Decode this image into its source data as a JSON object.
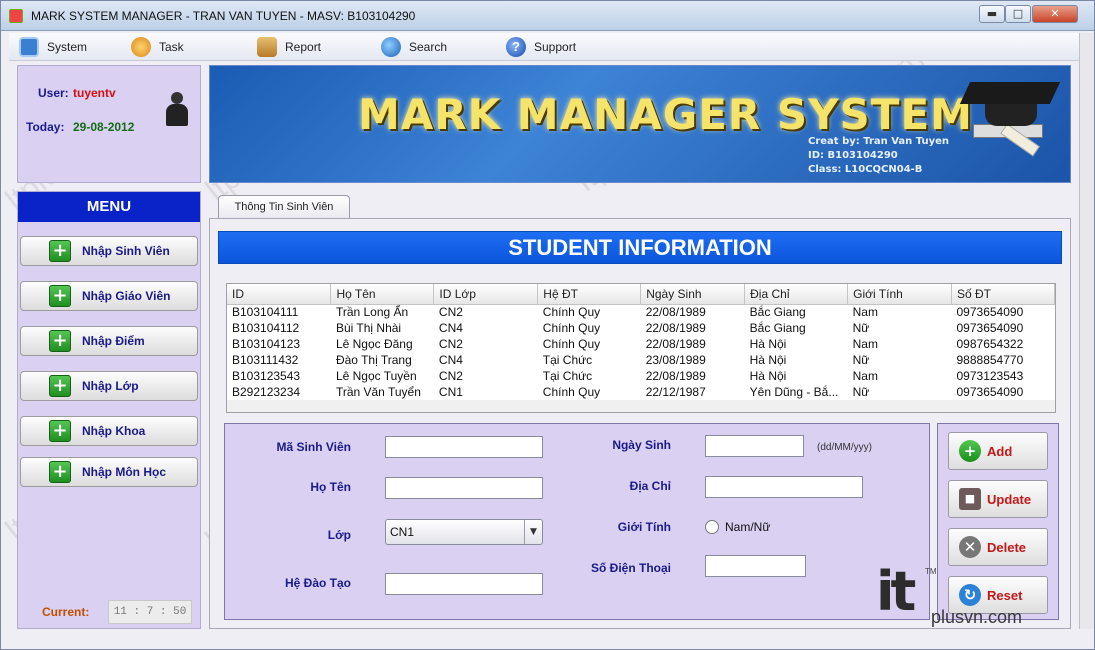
{
  "window": {
    "title": "MARK SYSTEM MANAGER -  TRAN VAN TUYEN - MASV: B103104290",
    "min_label": "▬",
    "max_label": "□",
    "close_label": "✕"
  },
  "menubar": {
    "items": [
      {
        "label": "System",
        "icon": "system-icon"
      },
      {
        "label": "Task",
        "icon": "clock-icon"
      },
      {
        "label": "Report",
        "icon": "report-icon"
      },
      {
        "label": "Search",
        "icon": "search-icon"
      },
      {
        "label": "Support",
        "icon": "help-icon"
      }
    ],
    "support_glyph": "?"
  },
  "user_panel": {
    "user_label": "User:",
    "user_value": "tuyentv",
    "today_label": "Today:",
    "today_value": "29-08-2012"
  },
  "banner": {
    "title": "MARK MANAGER SYSTEM",
    "created_by": "Creat by: Tran Van Tuyen",
    "id": "ID: B103104290",
    "class": "Class: L10CQCN04-B"
  },
  "side_menu": {
    "header": "MENU",
    "items": [
      "Nhập Sinh Viên",
      "Nhập Giáo Viên",
      "Nhập Điểm",
      "Nhập Lớp",
      "Nhập Khoa",
      "Nhập Môn Học"
    ],
    "current_label": "Current:",
    "current_value": "11 : 7 : 50"
  },
  "tabs": [
    {
      "label": "Thông Tin Sinh Viên",
      "selected": true
    }
  ],
  "main": {
    "header": "STUDENT INFORMATION"
  },
  "table": {
    "columns": [
      "ID",
      "Họ Tên",
      "ID Lớp",
      "Hệ ĐT",
      "Ngày Sinh",
      "Địa Chỉ",
      "Giới Tính",
      "Số ĐT"
    ],
    "rows": [
      [
        "B103104111",
        "Trần Long Ẩn",
        "CN2",
        "Chính Quy",
        "22/08/1989",
        "Bắc Giang",
        "Nam",
        "0973654090"
      ],
      [
        "B103104112",
        "Bùi Thị Nhài",
        "CN4",
        "Chính Quy",
        "22/08/1989",
        "Bắc Giang",
        "Nữ",
        "0973654090"
      ],
      [
        "B103104123",
        "Lê Ngọc Đăng",
        "CN2",
        "Chính Quy",
        "22/08/1989",
        "Hà Nội",
        "Nam",
        "0987654322"
      ],
      [
        "B103111432",
        "Đào Thị Trang",
        "CN4",
        "Tại Chức",
        "23/08/1989",
        "Hà Nội",
        "Nữ",
        "9888854770"
      ],
      [
        "B103123543",
        "Lê Ngọc Tuyền",
        "CN2",
        "Tại Chức",
        "22/08/1989",
        "Hà Nội",
        "Nam",
        "0973123543"
      ],
      [
        "B292123234",
        "Trần Văn Tuyển",
        "CN1",
        "Chính Quy",
        "22/12/1987",
        "Yên Dũng - Bắ...",
        "Nữ",
        "0973654090"
      ]
    ]
  },
  "form": {
    "ma_sv_label": "Mã Sinh Viên",
    "ho_ten_label": "Họ Tên",
    "lop_label": "Lớp",
    "he_dao_tao_label": "Hệ Đào Tạo",
    "ngay_sinh_label": "Ngày Sinh",
    "dia_chi_label": "Địa Chỉ",
    "gioi_tinh_label": "Giới Tính",
    "so_dien_thoai_label": "Số Điện Thoại",
    "ma_sv_value": "",
    "ho_ten_value": "",
    "lop_value": "CN1",
    "he_dao_tao_value": "",
    "ngay_sinh_value": "",
    "dia_chi_value": "",
    "so_dien_thoai_value": "",
    "date_hint": "(dd/MM/yyy)",
    "gender_radio_label": "Nam/Nữ",
    "combo_arrow": "▼"
  },
  "actions": {
    "add": "Add",
    "update": "Update",
    "delete": "Delete",
    "reset": "Reset"
  },
  "logo": {
    "it": "it",
    "tm": "TM",
    "plus": "plusvn.com"
  },
  "watermark": "ltplusvn.com",
  "colors": {
    "menu_header": "#0a23c8",
    "student_header": "#0a55dc",
    "panel_bg": "#d9d0f2",
    "label_text": "#1a1a8a",
    "action_text": "#c21818",
    "user_value": "#d21010",
    "today_value": "#146c14"
  }
}
